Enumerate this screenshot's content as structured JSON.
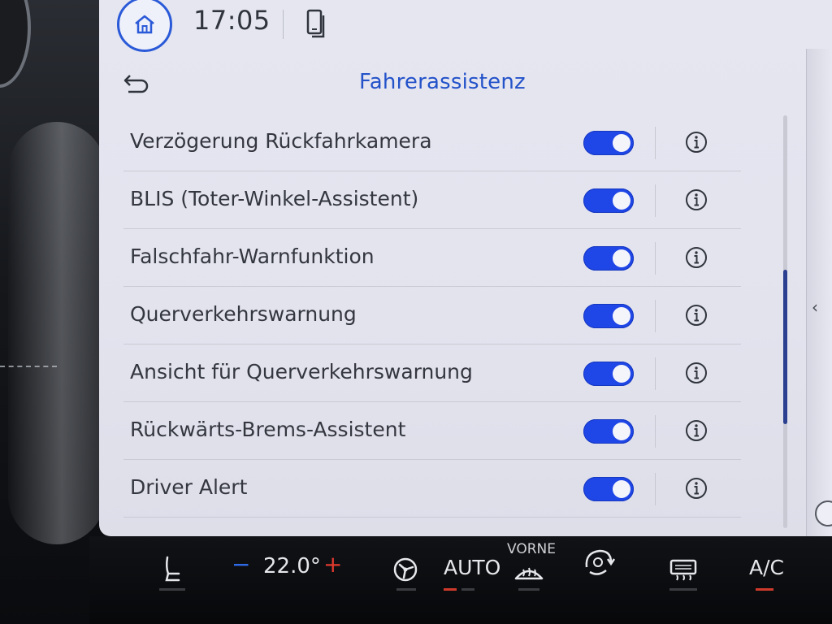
{
  "status_bar": {
    "time": "17:05",
    "icons": {
      "home": "home-icon",
      "phone": "phone-icon"
    }
  },
  "header": {
    "title": "Fahrerassistenz",
    "back_icon": "back-icon"
  },
  "settings": {
    "items": [
      {
        "label": "Verzögerung Rückfahrkamera",
        "enabled": true
      },
      {
        "label": "BLIS (Toter-Winkel-Assistent)",
        "enabled": true
      },
      {
        "label": "Falschfahr-Warnfunktion",
        "enabled": true
      },
      {
        "label": "Querverkehrswarnung",
        "enabled": true
      },
      {
        "label": "Ansicht für Querverkehrswarnung",
        "enabled": true
      },
      {
        "label": "Rückwärts-Brems-Assistent",
        "enabled": true
      },
      {
        "label": "Driver Alert",
        "enabled": true
      }
    ],
    "info_icon": "info-icon"
  },
  "side_panel": {
    "chevron": "‹"
  },
  "climate": {
    "minus": "−",
    "temperature": "22.0°",
    "plus": "+",
    "auto_label": "AUTO",
    "vorne_label": "VORNE",
    "ac_label": "A/C",
    "icons": {
      "seat": "seat-heating-icon",
      "fan": "fan-icon",
      "windshield": "front-defrost-icon",
      "recirc": "recirculation-icon",
      "rear_defrost": "rear-defrost-icon"
    }
  },
  "colors": {
    "accent": "#2352c9",
    "toggle_on": "#1f46e6",
    "screen_bg": "#e4e4ef",
    "temp_minus": "#2f6be8",
    "temp_plus": "#e03a2e",
    "indicator_on": "#d03a2c"
  }
}
